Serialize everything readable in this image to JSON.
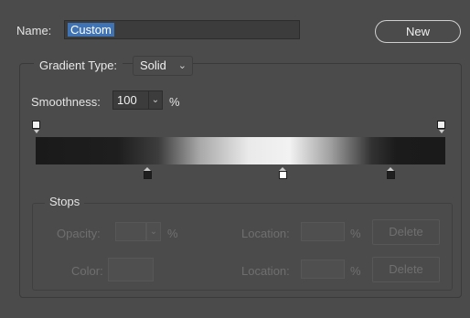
{
  "name_row": {
    "label": "Name:",
    "value": "Custom",
    "new_button": "New"
  },
  "gradient_type": {
    "label": "Gradient Type:",
    "selected": "Solid",
    "chevron": "⌄"
  },
  "smoothness": {
    "label": "Smoothness:",
    "value": "100",
    "chevron": "⌄",
    "unit": "%"
  },
  "stops": {
    "title": "Stops",
    "opacity_label": "Opacity:",
    "opacity_unit": "%",
    "opacity_location_label": "Location:",
    "opacity_location_unit": "%",
    "opacity_delete": "Delete",
    "color_label": "Color:",
    "color_location_label": "Location:",
    "color_location_unit": "%",
    "color_delete": "Delete"
  },
  "colors": {
    "selection": "#3f73b4",
    "panel": "#4b4b4b"
  }
}
